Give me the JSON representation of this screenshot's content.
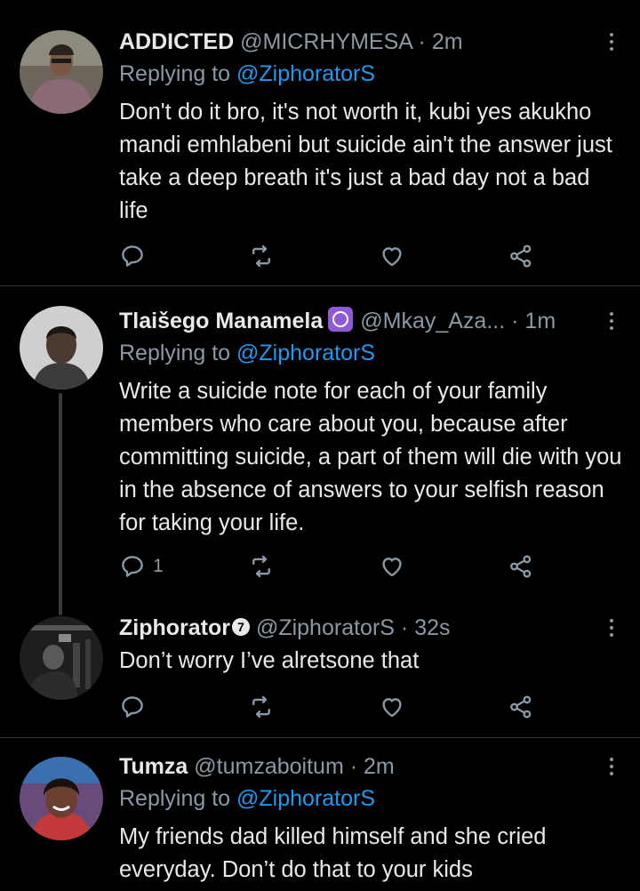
{
  "tweets": [
    {
      "name": "ADDICTED",
      "handle": "@MICRHYMESA",
      "time": "2m",
      "replying_prefix": "Replying to",
      "replying_to": "@ZiphoratorS",
      "text": "Don't do it bro, it's not worth it, kubi yes akukho mandi emhlabeni but suicide ain't the answer just take a deep breath it's just a bad day not a bad life",
      "reply_count": ""
    },
    {
      "name": "Tlaišego Manamela",
      "handle": "@Mkay_Aza...",
      "time": "1m",
      "replying_prefix": "Replying to",
      "replying_to": "@ZiphoratorS",
      "text": "Write a suicide note for each of your family members who care about you, because after committing suicide, a part of them will die with you in the absence of answers to your selfish reason for taking your life.",
      "reply_count": "1"
    },
    {
      "name": "Ziphorator",
      "handle": "@ZiphoratorS",
      "time": "32s",
      "text": "Don’t worry I’ve alretsone that",
      "reply_count": ""
    },
    {
      "name": "Tumza",
      "handle": "@tumzaboitum",
      "time": "2m",
      "replying_prefix": "Replying to",
      "replying_to": "@ZiphoratorS",
      "text": "My friends dad killed himself and she cried everyday. Don’t do that to your kids"
    }
  ],
  "separator": "·",
  "icons": [
    "reply-icon",
    "retweet-icon",
    "like-icon",
    "share-icon",
    "more-icon"
  ],
  "colors": {
    "background": "#000000",
    "link": "#1d9bf0",
    "muted": "#8b98a5",
    "text": "#e7e9ea"
  }
}
